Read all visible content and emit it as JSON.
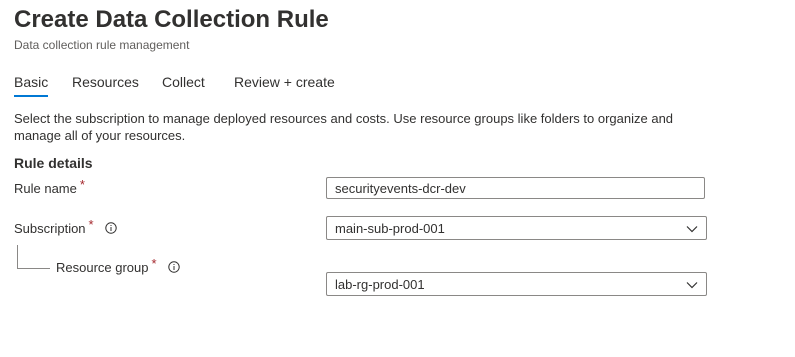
{
  "header": {
    "title": "Create Data Collection Rule",
    "subtitle": "Data collection rule management"
  },
  "tabs": [
    {
      "label": "Basic",
      "active": true
    },
    {
      "label": "Resources",
      "active": false
    },
    {
      "label": "Collect",
      "active": false
    },
    {
      "label": "Review + create",
      "active": false
    }
  ],
  "description": "Select the subscription to manage deployed resources and costs. Use resource groups like folders to organize and manage all of your resources.",
  "rule_details": {
    "heading": "Rule details",
    "rule_name": {
      "label": "Rule name",
      "required_marker": "*",
      "value": "securityevents-dcr-dev"
    },
    "subscription": {
      "label": "Subscription",
      "required_marker": "*",
      "info_icon": "info-icon",
      "selected": "main-sub-prod-001"
    },
    "resource_group": {
      "label": "Resource group",
      "required_marker": "*",
      "info_icon": "info-icon",
      "selected": "lab-rg-prod-001"
    }
  },
  "colors": {
    "accent": "#0078d4",
    "required": "#a4262c",
    "text": "#323130",
    "secondary_text": "#605e5c",
    "border": "#8a8886"
  }
}
